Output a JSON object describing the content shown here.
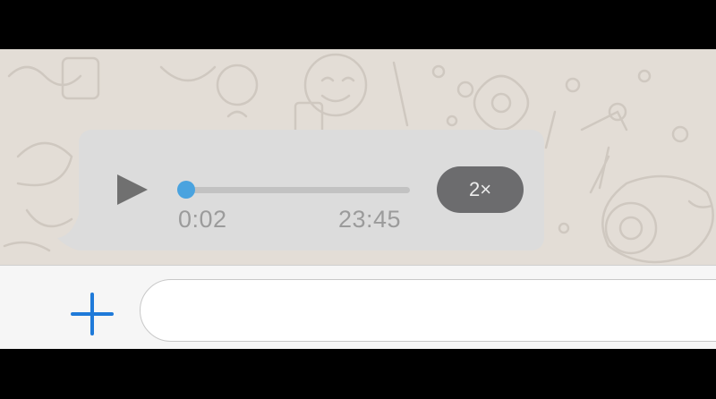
{
  "voice_message": {
    "elapsed": "0:02",
    "duration": "23:45",
    "progress": 0.0,
    "speed_label": "2×"
  },
  "composer": {
    "message_value": "",
    "placeholder": ""
  },
  "colors": {
    "chat_background": "#e3ddd6",
    "bubble": "#dcdcdc",
    "accent": "#4aa3df",
    "speed_button": "#6c6c6e",
    "plus_icon": "#1f7ad9"
  },
  "icons": {
    "play": "play-icon",
    "attach": "plus-icon"
  }
}
